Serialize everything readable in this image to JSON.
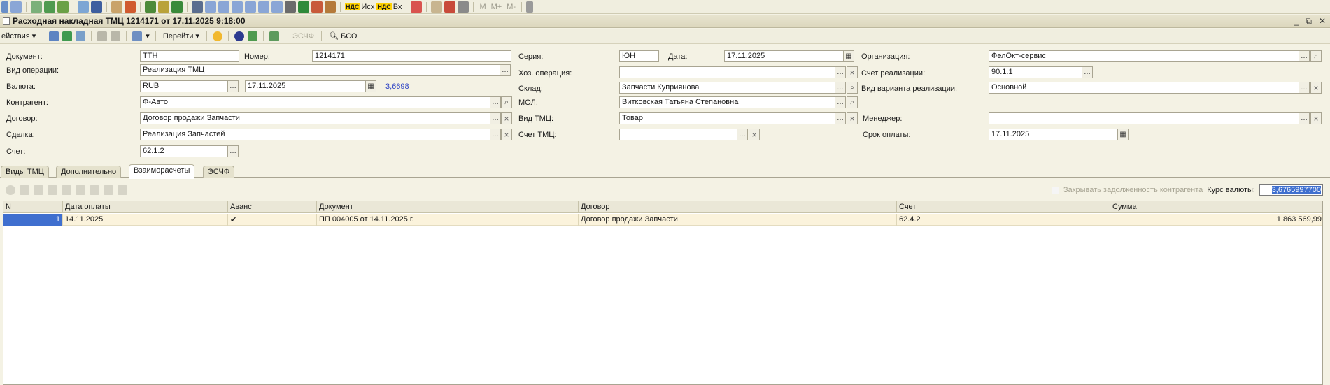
{
  "toolbar": {
    "icons": [
      "calc-icon",
      "grid-icon",
      "dt-kt-icon",
      "move-icon",
      "book-icon",
      "users-icon",
      "user-icon",
      "report-icon",
      "tree-icon",
      "table-icon",
      "chart-icon",
      "print-icon",
      "doc1-icon",
      "doc2-icon",
      "doc3-icon",
      "doc4-icon",
      "doc5-icon",
      "cart-icon",
      "excel-icon",
      "stats-icon"
    ],
    "outgoing_label": "Исх",
    "incoming_label": "Вх",
    "nds_badge": "НДС",
    "m_label": "M",
    "mplus_label": "M+",
    "mminus_label": "M-"
  },
  "window": {
    "title": "Расходная накладная ТМЦ 1214171 от 17.11.2025 9:18:00",
    "controls": [
      "_",
      "⧉",
      "✕"
    ]
  },
  "actions": {
    "menu": "ействия",
    "goto": "Перейти",
    "eschf": "ЭСЧФ",
    "bso": "БСО"
  },
  "form": {
    "document_label": "Документ:",
    "document_value": "ТТН",
    "number_label": "Номер:",
    "number_value": "1214171",
    "series_label": "Серия:",
    "series_value": "ЮН",
    "date_label": "Дата:",
    "date_value": "17.11.2025",
    "org_label": "Организация:",
    "org_value": "ФелОкт-сервис",
    "op_type_label": "Вид операции:",
    "op_type_value": "Реализация ТМЦ",
    "biz_op_label": "Хоз. операция:",
    "biz_op_value": "",
    "sales_account_label": "Счет реализации:",
    "sales_account_value": "90.1.1",
    "currency_label": "Валюта:",
    "currency_value": "RUB",
    "currency_date_value": "17.11.2025",
    "currency_rate_value": "3,6698",
    "warehouse_label": "Склад:",
    "warehouse_value": "Запчасти Куприянова",
    "sale_variant_label": "Вид варианта реализации:",
    "sale_variant_value": "Основной",
    "counterparty_label": "Контрагент:",
    "counterparty_value": "Ф-Авто",
    "mol_label": "МОЛ:",
    "mol_value": "Витковская Татьяна Степановна",
    "contract_label": "Договор:",
    "contract_value": "Договор продажи Запчасти",
    "tmc_type_label": "Вид ТМЦ:",
    "tmc_type_value": "Товар",
    "manager_label": "Менеджер:",
    "manager_value": "",
    "deal_label": "Сделка:",
    "deal_value": "Реализация Запчастей",
    "tmc_account_label": "Счет ТМЦ:",
    "tmc_account_value": "",
    "payment_term_label": "Срок оплаты:",
    "payment_term_value": "17.11.2025",
    "account_label": "Счет:",
    "account_value": "62.1.2"
  },
  "tabs": [
    "Виды ТМЦ",
    "Дополнительно",
    "Взаиморасчеты",
    "ЭСЧФ"
  ],
  "active_tab": "Взаиморасчеты",
  "table_controls": {
    "close_debt_label": "Закрывать задолженность контрагента",
    "rate_label": "Курс валюты:",
    "rate_value": "3,6765997700"
  },
  "table": {
    "columns": [
      "N",
      "Дата оплаты",
      "Аванс",
      "Документ",
      "Договор",
      "Счет",
      "Сумма"
    ],
    "rows": [
      [
        "1",
        "14.11.2025",
        "✔",
        "ПП 004005 от 14.11.2025 г.",
        "Договор продажи Запчасти",
        "62.4.2",
        "1 863 569,99"
      ]
    ]
  }
}
